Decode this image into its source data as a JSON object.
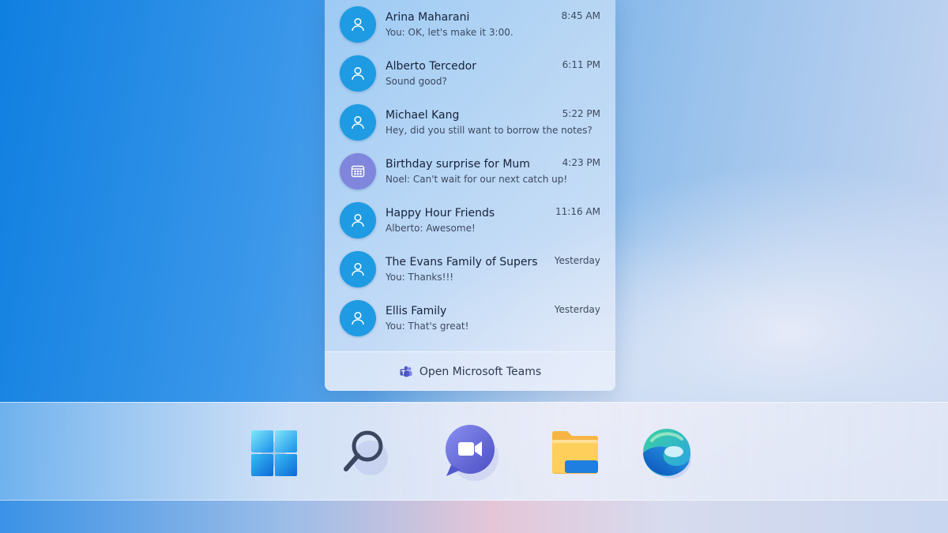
{
  "chats": [
    {
      "name": "Arina Maharani",
      "preview": "You: OK, let's make it 3:00.",
      "time": "8:45 AM",
      "avatar": "person-icon"
    },
    {
      "name": "Alberto Tercedor",
      "preview": "Sound good?",
      "time": "6:11 PM",
      "avatar": "person-icon"
    },
    {
      "name": "Michael Kang",
      "preview": "Hey, did you still want to borrow the notes?",
      "time": "5:22 PM",
      "avatar": "person-icon"
    },
    {
      "name": "Birthday surprise for Mum",
      "preview": "Noel: Can't wait for our next catch up!",
      "time": "4:23 PM",
      "avatar": "calendar-icon"
    },
    {
      "name": "Happy Hour Friends",
      "preview": "Alberto: Awesome!",
      "time": "11:16 AM",
      "avatar": "person-icon"
    },
    {
      "name": "The Evans Family of Supers",
      "preview": "You: Thanks!!!",
      "time": "Yesterday",
      "avatar": "person-icon"
    },
    {
      "name": "Ellis Family",
      "preview": "You: That's great!",
      "time": "Yesterday",
      "avatar": "person-icon"
    }
  ],
  "footer": {
    "label": "Open Microsoft Teams",
    "icon": "teams-icon"
  },
  "taskbar": [
    {
      "icon": "windows-start-icon"
    },
    {
      "icon": "search-icon"
    },
    {
      "icon": "teams-chat-icon"
    },
    {
      "icon": "file-explorer-icon"
    },
    {
      "icon": "edge-browser-icon"
    }
  ],
  "colors": {
    "avatar_person": "#1e9be3",
    "avatar_calendar": "#7f86dc",
    "text_primary": "#16233a",
    "text_secondary": "#3d4a60"
  }
}
